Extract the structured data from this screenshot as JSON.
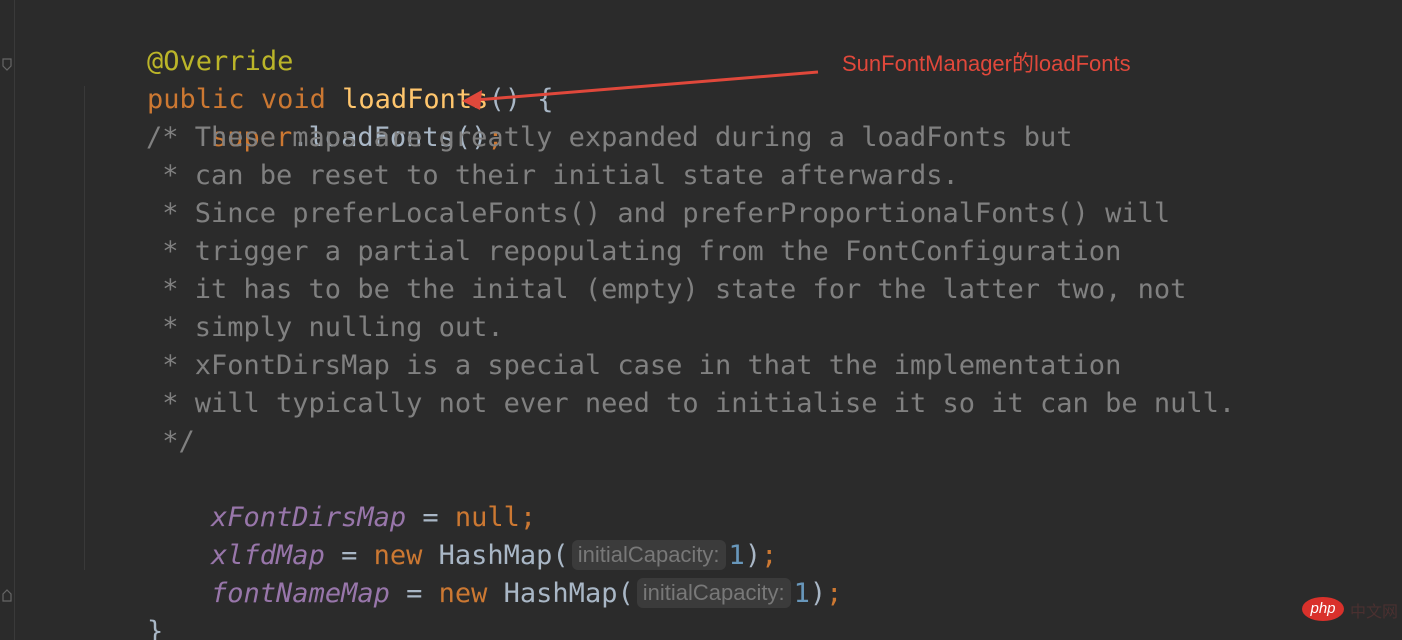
{
  "code": {
    "annotation": "@Override",
    "method_signature": {
      "modifier": "public",
      "return_type": "void",
      "name": "loadFonts",
      "rest": "() {"
    },
    "super_call": {
      "keyword": "super",
      "dot": ".",
      "call": "loadFonts()",
      "semicolon": ";"
    },
    "comment_lines": [
      "/* These maps are greatly expanded during a loadFonts but",
      " * can be reset to their initial state afterwards.",
      " * Since preferLocaleFonts() and preferProportionalFonts() will",
      " * trigger a partial repopulating from the FontConfiguration",
      " * it has to be the inital (empty) state for the latter two, not",
      " * simply nulling out.",
      " * xFontDirsMap is a special case in that the implementation",
      " * will typically not ever need to initialise it so it can be null.",
      " */"
    ],
    "assign_1": {
      "field": "xFontDirsMap",
      "op": " = ",
      "value": "null",
      "semicolon": ";"
    },
    "assign_2": {
      "field": "xlfdMap",
      "op": " = ",
      "new_kw": "new",
      "type": " HashMap(",
      "hint": "initialCapacity:",
      "arg": "1",
      "close": ")",
      "semicolon": ";"
    },
    "assign_3": {
      "field": "fontNameMap",
      "op": " = ",
      "new_kw": "new",
      "type": " HashMap(",
      "hint": "initialCapacity:",
      "arg": "1",
      "close": ")",
      "semicolon": ";"
    },
    "closing_brace": "}"
  },
  "callout": {
    "text": "SunFontManager的loadFonts",
    "color": "#e0483b"
  },
  "watermark": {
    "badge": "php",
    "tail": "中文网"
  },
  "colors": {
    "background": "#2b2b2b",
    "keyword": "#cc7832",
    "annotation": "#bbb529",
    "method": "#ffc66d",
    "comment": "#808080",
    "field": "#9876aa",
    "number": "#6897bb",
    "text": "#a9b7c6"
  }
}
